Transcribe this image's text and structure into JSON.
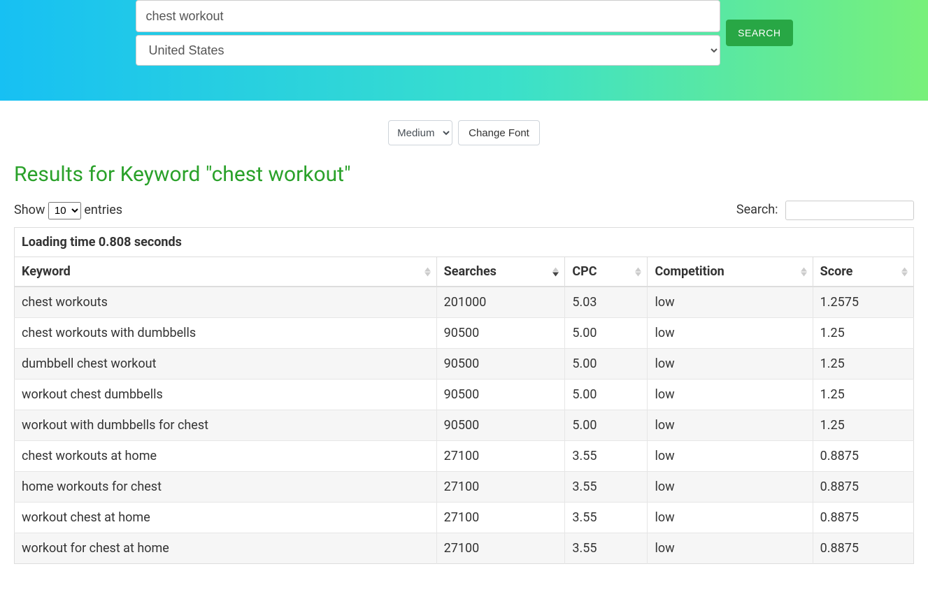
{
  "hero": {
    "keyword_value": "chest workout",
    "country_selected": "United States",
    "search_label": "SEARCH"
  },
  "tools": {
    "font_size_selected": "Medium",
    "change_font_label": "Change Font"
  },
  "results": {
    "title": "Results for Keyword \"chest workout\"",
    "show_prefix": "Show",
    "entries_suffix": "entries",
    "page_size_selected": "10",
    "search_label": "Search:",
    "loading_text": "Loading time 0.808 seconds",
    "columns": {
      "keyword": "Keyword",
      "searches": "Searches",
      "cpc": "CPC",
      "competition": "Competition",
      "score": "Score"
    },
    "sorted_column": "searches",
    "sorted_direction": "desc",
    "rows": [
      {
        "keyword": "chest workouts",
        "searches": "201000",
        "cpc": "5.03",
        "competition": "low",
        "score": "1.2575"
      },
      {
        "keyword": "chest workouts with dumbbells",
        "searches": "90500",
        "cpc": "5.00",
        "competition": "low",
        "score": "1.25"
      },
      {
        "keyword": "dumbbell chest workout",
        "searches": "90500",
        "cpc": "5.00",
        "competition": "low",
        "score": "1.25"
      },
      {
        "keyword": "workout chest dumbbells",
        "searches": "90500",
        "cpc": "5.00",
        "competition": "low",
        "score": "1.25"
      },
      {
        "keyword": "workout with dumbbells for chest",
        "searches": "90500",
        "cpc": "5.00",
        "competition": "low",
        "score": "1.25"
      },
      {
        "keyword": "chest workouts at home",
        "searches": "27100",
        "cpc": "3.55",
        "competition": "low",
        "score": "0.8875"
      },
      {
        "keyword": "home workouts for chest",
        "searches": "27100",
        "cpc": "3.55",
        "competition": "low",
        "score": "0.8875"
      },
      {
        "keyword": "workout chest at home",
        "searches": "27100",
        "cpc": "3.55",
        "competition": "low",
        "score": "0.8875"
      },
      {
        "keyword": "workout for chest at home",
        "searches": "27100",
        "cpc": "3.55",
        "competition": "low",
        "score": "0.8875"
      }
    ]
  }
}
